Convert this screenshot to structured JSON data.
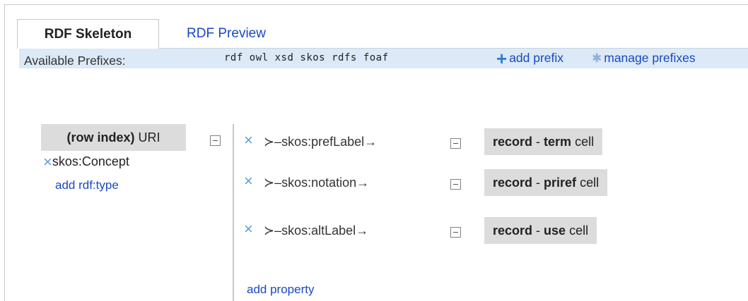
{
  "tabs": [
    {
      "label": "RDF Skeleton",
      "active": true
    },
    {
      "label": "RDF Preview",
      "active": false
    }
  ],
  "prefix_bar": {
    "label": "Available Prefixes:",
    "prefixes": [
      "rdf",
      "owl",
      "xsd",
      "skos",
      "rdfs",
      "foaf"
    ],
    "add_prefix": "add prefix",
    "manage_prefixes": "manage prefixes"
  },
  "subject": {
    "index_label": "(row index)",
    "kind": "URI",
    "type": "skos:Concept",
    "add_type": "add rdf:type"
  },
  "properties": [
    {
      "name": "skos:prefLabel",
      "cell_source": "record",
      "cell_column": "term",
      "cell_suffix": "cell"
    },
    {
      "name": "skos:notation",
      "cell_source": "record",
      "cell_column": "priref",
      "cell_suffix": "cell"
    },
    {
      "name": "skos:altLabel",
      "cell_source": "record",
      "cell_column": "use",
      "cell_suffix": "cell"
    }
  ],
  "add_property": "add property",
  "colors": {
    "link": "#1a48c4",
    "prefix_bar_bg": "#dce9f6",
    "node_bg": "#dcdcdc",
    "remove_icon": "#5c9be3"
  }
}
